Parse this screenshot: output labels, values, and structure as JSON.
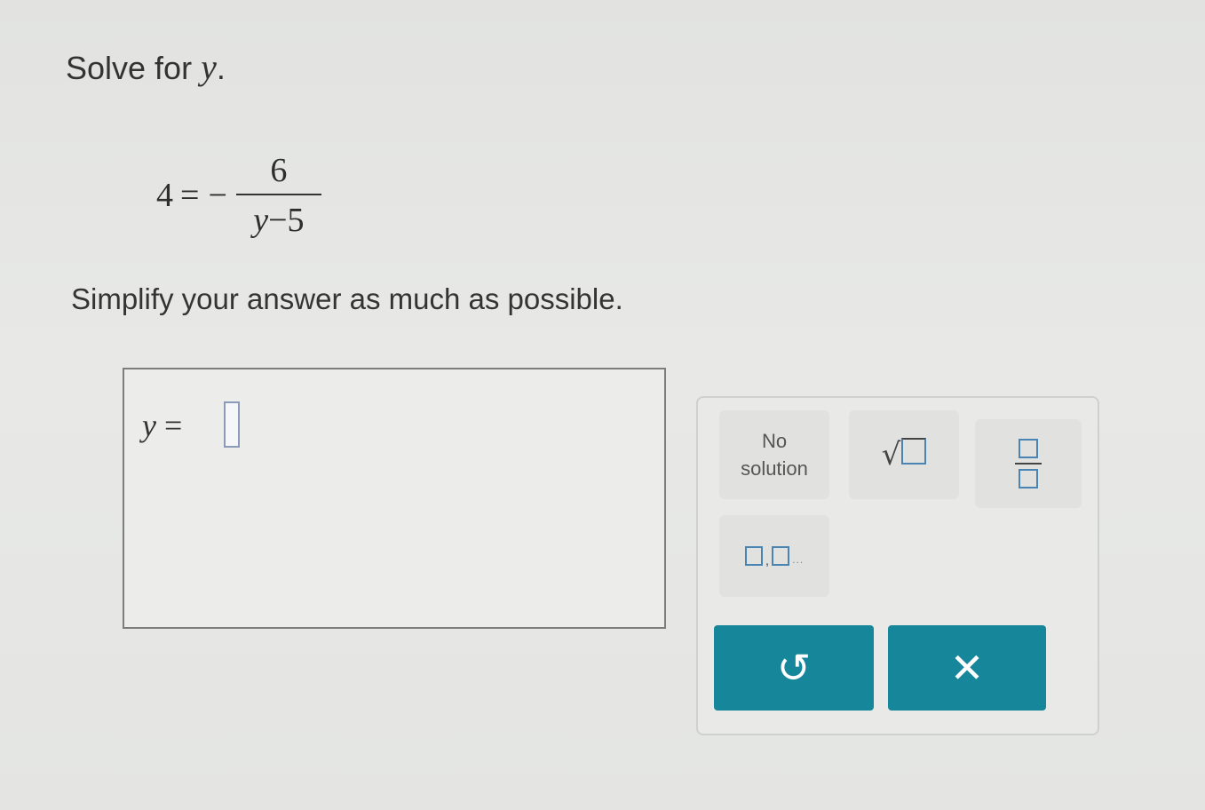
{
  "prompt": {
    "text": "Solve for ",
    "variable": "y",
    "period": "."
  },
  "equation": {
    "lhs": "4",
    "equals": "=",
    "sign": "−",
    "numerator": "6",
    "denominator_var": "y",
    "denominator_op": "−",
    "denominator_const": "5"
  },
  "instruction": "Simplify your answer as much as possible.",
  "answer": {
    "variable": "y",
    "equals": "=",
    "value": ""
  },
  "toolbar": {
    "no_solution_line1": "No",
    "no_solution_line2": "solution",
    "sqrt_symbol": "√",
    "ellipsis_comma": ",",
    "ellipsis_dots": "..."
  },
  "actions": {
    "undo_symbol": "↺",
    "clear_symbol": "✕"
  },
  "colors": {
    "action_button": "#16869b",
    "input_border": "#8a9ab8",
    "placeholder_box": "#4a84b3"
  },
  "icons": [
    "sqrt-icon",
    "fraction-icon",
    "ellipsis-list-icon",
    "undo-icon",
    "clear-icon"
  ]
}
